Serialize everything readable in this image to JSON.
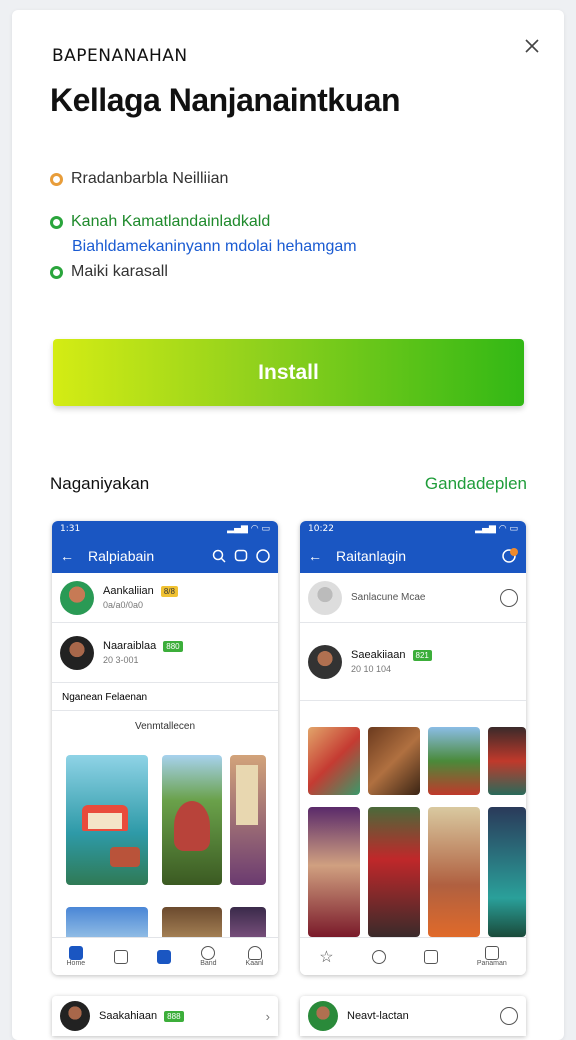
{
  "header": {
    "brand": "BAPENANAHAN",
    "close_icon": "close-icon",
    "title": "Kellaga Nanjanaintkuan"
  },
  "features": [
    {
      "text": "Rradanbarbla Neilliian",
      "color": "#e89d3a",
      "text_color": "#333333"
    },
    {
      "text": "Kanah Kamatlandainladkald",
      "color": "#2aa53c",
      "text_color": "#1f8a2c"
    },
    {
      "text": "Biahldamekaninyann mdolai hehamgam",
      "color": "",
      "text_color": "#1a5bd2"
    },
    {
      "text": "Maiki karasall",
      "color": "#2aa53c",
      "text_color": "#333333"
    }
  ],
  "install_button": {
    "label": "Install"
  },
  "screenshots": {
    "section_title": "Naganiyakan",
    "link_label": "Gandadeplen"
  },
  "phone1": {
    "status_time": "1:31",
    "title": "Ralpiabain",
    "rows": [
      {
        "name": "Aankaliian",
        "badge": "8/8",
        "badge_color": "#f1c232",
        "sub": "0a/a0/0a0"
      },
      {
        "name": "Naaraiblaa",
        "badge": "880",
        "badge_color": "#3cae3a",
        "sub": "20 3-001"
      }
    ],
    "section_label": "Nganean Felaenan",
    "gallery_label": "Venmtallecen",
    "tabs": [
      {
        "label": "Home",
        "icon": "home-icon"
      },
      {
        "label": "",
        "icon": "square-icon"
      },
      {
        "label": "",
        "icon": "edit-icon"
      },
      {
        "label": "Band",
        "icon": "globe-icon"
      },
      {
        "label": "Kaanl",
        "icon": "person-icon"
      }
    ]
  },
  "phone2": {
    "status_time": "10:22",
    "title": "Raitanlagin",
    "rows": [
      {
        "name": "Sanlacune Mcae",
        "badge": "",
        "badge_color": "",
        "sub": ""
      },
      {
        "name": "Saeakiiaan",
        "badge": "821",
        "badge_color": "#3cae3a",
        "sub": "20 10 104"
      }
    ],
    "tabs": [
      {
        "label": "",
        "icon": "star-icon"
      },
      {
        "label": "",
        "icon": "chat-icon"
      },
      {
        "label": "",
        "icon": "image-icon"
      },
      {
        "label": "Panaman",
        "icon": "list-icon"
      }
    ]
  },
  "bottom_cards": [
    {
      "name": "Saakahiaan",
      "badge": "888",
      "sub": ""
    },
    {
      "name": "Neavt-lactan",
      "badge": "",
      "sub": ""
    }
  ]
}
